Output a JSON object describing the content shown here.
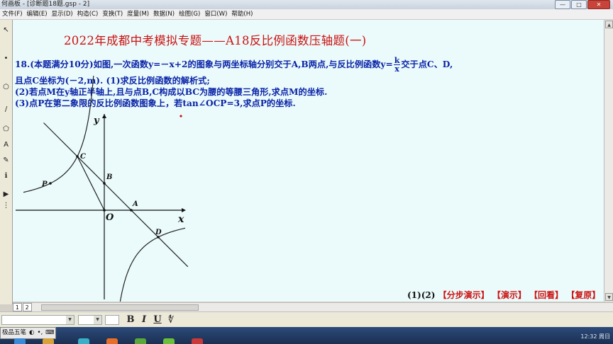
{
  "window": {
    "title": "何画板 - [诊断题18题.gsp - 2]",
    "buttons": {
      "minimize": "—",
      "maximize": "□",
      "close": "✕"
    }
  },
  "menubar": {
    "items": [
      "文件(F)",
      "编辑(E)",
      "显示(D)",
      "构造(C)",
      "变换(T)",
      "度量(M)",
      "数据(N)",
      "绘图(G)",
      "窗口(W)",
      "帮助(H)"
    ]
  },
  "toolbox": {
    "tools": [
      {
        "glyph": "↖",
        "icon": "arrow-select-icon"
      },
      {
        "glyph": "•",
        "icon": "point-tool-icon"
      },
      {
        "glyph": "○",
        "icon": "compass-tool-icon"
      },
      {
        "glyph": "/",
        "icon": "straightedge-tool-icon"
      },
      {
        "glyph": "⬠",
        "icon": "polygon-tool-icon"
      },
      {
        "glyph": "A",
        "icon": "text-tool-icon"
      },
      {
        "glyph": "✎",
        "icon": "marker-tool-icon"
      },
      {
        "glyph": "ℹ",
        "icon": "info-tool-icon"
      },
      {
        "glyph": "▶",
        "icon": "custom-tool-icon"
      },
      {
        "glyph": "⋮",
        "icon": "more-tools-icon"
      }
    ]
  },
  "sheet": {
    "title": "2022年成都中考模拟专题——A18反比例函数压轴题(一)",
    "problem": {
      "line1_pre": "18.(本题满分10分)如图,一次函数y=－x+2的图象与两坐标轴分别交于A,B两点,与反比例函数y=",
      "frac_num": "k",
      "frac_den": "x",
      "line1_post": "交于点C、D,",
      "line2": "且点C坐标为(－2,m). (1)求反比例函数的解析式;",
      "line3": "(2)若点M在y轴正半轴上,且与点B,C构成以BC为腰的等腰三角形,求点M的坐标.",
      "line4": "(3)点P在第二象限的反比例函数图象上，若tan∠OCP=3,求点P的坐标."
    },
    "graph": {
      "labels": {
        "x_axis": "x",
        "y_axis": "y",
        "origin": "O",
        "A": "A",
        "B": "B",
        "C": "C",
        "D": "D",
        "P": "P"
      },
      "colors": {
        "axis": "#111111",
        "curve": "#222222",
        "line": "#222222",
        "stray_point": "#cc1111"
      }
    },
    "demo_bar": {
      "lead": "(1)(2)",
      "buttons": [
        "【分步演示】",
        "【演示】",
        "【回看】",
        "【复原】"
      ]
    }
  },
  "page_tabs": [
    "1",
    "2"
  ],
  "formatbar": {
    "bold": "B",
    "italic": "I",
    "underline": "U",
    "special": "∜"
  },
  "ime": {
    "label": "极品五笔",
    "icons": [
      "◐",
      "•,",
      "⌨"
    ]
  },
  "clock": "12:32 周日"
}
